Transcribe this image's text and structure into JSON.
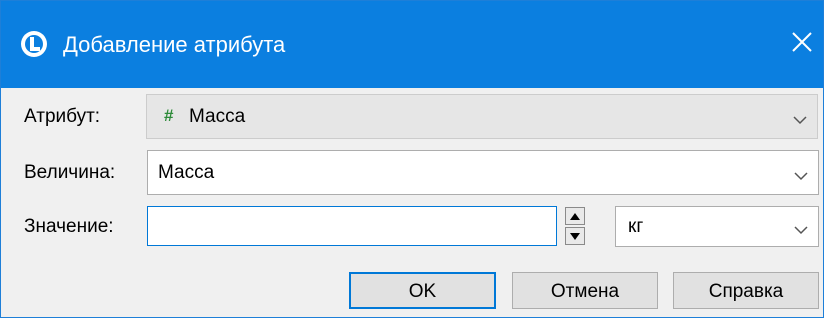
{
  "dialog": {
    "title": "Добавление атрибута",
    "accent_color": "#0b7fe0",
    "icons": {
      "app": "app-logo-icon",
      "close": "close-icon"
    }
  },
  "form": {
    "attribute": {
      "label": "Атрибут:",
      "value": "Масса",
      "type_icon": "#",
      "enabled": false
    },
    "quantity": {
      "label": "Величина:",
      "value": "Масса"
    },
    "value": {
      "label": "Значение:",
      "text": "",
      "unit": "кг"
    }
  },
  "buttons": {
    "ok": "OK",
    "cancel": "Отмена",
    "help": "Справка"
  }
}
